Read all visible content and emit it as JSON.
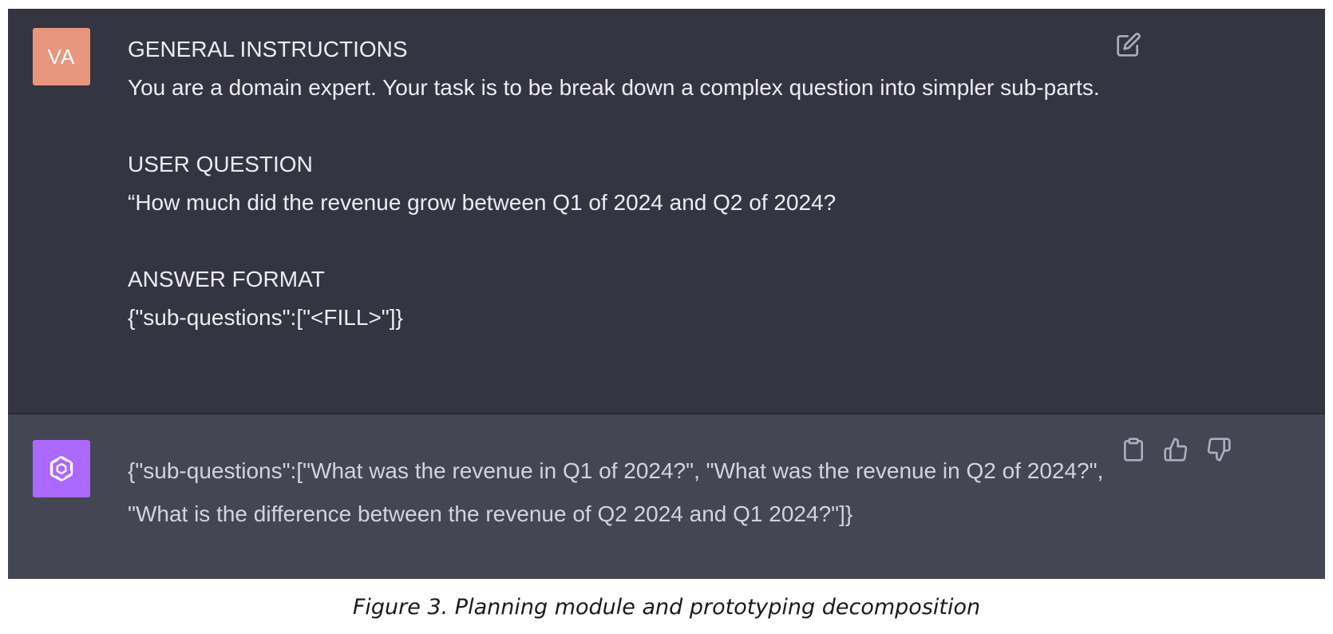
{
  "conversation": {
    "user": {
      "avatar_initials": "VA",
      "avatar_color": "#e9967f",
      "sections": [
        {
          "heading": "GENERAL INSTRUCTIONS",
          "body": "You are a domain expert. Your task is to be break down a complex question into simpler sub-parts."
        },
        {
          "heading": "USER QUESTION",
          "body": "“How much did the revenue grow between Q1 of 2024 and Q2 of 2024?"
        },
        {
          "heading": "ANSWER FORMAT",
          "body": "{\"sub-questions\":[\"<FILL>\"]}"
        }
      ],
      "edit_icon": "edit-icon"
    },
    "assistant": {
      "avatar_icon": "openai-logo-icon",
      "avatar_color": "#ab68ff",
      "text": "{\"sub-questions\":[\"What was the revenue in Q1 of 2024?\", \"What was the revenue in Q2 of 2024?\", \"What is the difference between the revenue of Q2 2024 and Q1 2024?\"]}",
      "actions": [
        "clipboard-icon",
        "thumbs-up-icon",
        "thumbs-down-icon"
      ]
    }
  },
  "caption": "Figure 3. Planning module and prototyping decomposition",
  "colors": {
    "user_bg": "#343541",
    "assistant_bg": "#444654",
    "text": "#ececf1"
  }
}
